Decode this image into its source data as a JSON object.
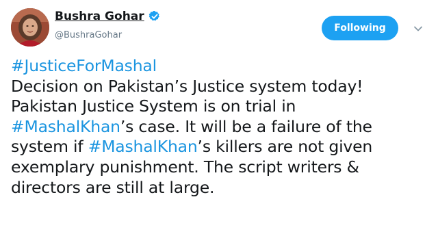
{
  "author": {
    "display_name": "Bushra Gohar",
    "handle": "@BushraGohar",
    "verified": true,
    "avatar_icon": "profile-photo"
  },
  "follow_button": {
    "label": "Following",
    "color": "#1da1f2"
  },
  "menu": {
    "icon": "chevron-down-icon"
  },
  "tweet": {
    "lines": [
      [
        {
          "text": "#JusticeForMashal",
          "hashtag": true
        }
      ],
      [
        {
          "text": "Decision on Pakistan’s Justice system today!",
          "hashtag": false
        }
      ],
      [
        {
          "text": "Pakistan Justice System is on trial in",
          "hashtag": false
        }
      ],
      [
        {
          "text": "#MashalKhan",
          "hashtag": true
        },
        {
          "text": "’s case. It will be a failure of the",
          "hashtag": false
        }
      ],
      [
        {
          "text": "system if ",
          "hashtag": false
        },
        {
          "text": "#MashalKhan",
          "hashtag": true
        },
        {
          "text": "’s killers are not given",
          "hashtag": false
        }
      ],
      [
        {
          "text": "exemplary punishment.  The script writers &",
          "hashtag": false
        }
      ],
      [
        {
          "text": "directors are still at large.",
          "hashtag": false
        }
      ]
    ]
  },
  "colors": {
    "hashtag": "#1b95e0",
    "text": "#14171a",
    "secondary": "#657786",
    "verified": "#1da1f2"
  }
}
